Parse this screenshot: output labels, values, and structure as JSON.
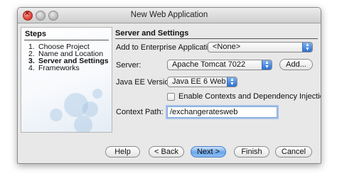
{
  "window": {
    "title": "New Web Application"
  },
  "steps": {
    "heading": "Steps",
    "items": [
      {
        "num": "1.",
        "label": "Choose Project"
      },
      {
        "num": "2.",
        "label": "Name and Location"
      },
      {
        "num": "3.",
        "label": "Server and Settings"
      },
      {
        "num": "4.",
        "label": "Frameworks"
      }
    ],
    "current_index": 2
  },
  "panel": {
    "title": "Server and Settings",
    "enterprise_label": "Add to Enterprise Application:",
    "enterprise_value": "<None>",
    "server_label": "Server:",
    "server_value": "Apache Tomcat 7022",
    "add_button": "Add...",
    "javaee_label": "Java EE Version:",
    "javaee_value": "Java EE 6 Web",
    "cdi_label": "Enable Contexts and Dependency Injection",
    "cdi_checked": false,
    "context_label": "Context Path:",
    "context_value": "/exchangeratesweb"
  },
  "footer": {
    "help": "Help",
    "back": "< Back",
    "next": "Next >",
    "finish": "Finish",
    "cancel": "Cancel"
  },
  "colors": {
    "accent": "#2b6fd1",
    "default_button": "#6aa6ea"
  }
}
